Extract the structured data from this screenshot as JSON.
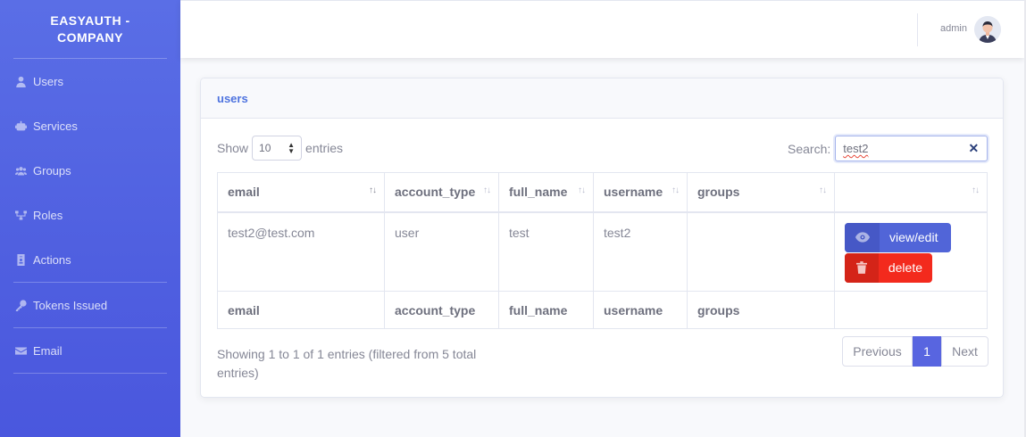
{
  "brand": {
    "line1": "EASYAUTH -",
    "line2": "COMPANY"
  },
  "sidebar": {
    "items": [
      {
        "label": "Users",
        "icon": "user-icon"
      },
      {
        "label": "Services",
        "icon": "robot-icon"
      },
      {
        "label": "Groups",
        "icon": "users-icon"
      },
      {
        "label": "Roles",
        "icon": "sitemap-icon"
      },
      {
        "label": "Actions",
        "icon": "id-badge-icon"
      },
      {
        "label": "Tokens Issued",
        "icon": "key-icon"
      },
      {
        "label": "Email",
        "icon": "envelope-icon"
      }
    ]
  },
  "topbar": {
    "username": "admin",
    "avatar_icon": "avatar-icon"
  },
  "card": {
    "title": "users"
  },
  "table_controls": {
    "show_label": "Show",
    "entries_value": "10",
    "entries_label": "entries",
    "search_label": "Search:",
    "search_value": "test2"
  },
  "table": {
    "columns": [
      "email",
      "account_type",
      "full_name",
      "username",
      "groups",
      ""
    ],
    "rows": [
      {
        "email": "test2@test.com",
        "account_type": "user",
        "full_name": "test",
        "username": "test2",
        "groups": ""
      }
    ],
    "actions": {
      "view_label": "view/edit",
      "delete_label": "delete"
    }
  },
  "footer": {
    "info": "Showing 1 to 1 of 1 entries (filtered from 5 total entries)",
    "prev_label": "Previous",
    "page": "1",
    "next_label": "Next"
  },
  "colors": {
    "sidebar": "#4e5fe0",
    "primary": "#4e73df",
    "danger": "#f32a1d"
  }
}
